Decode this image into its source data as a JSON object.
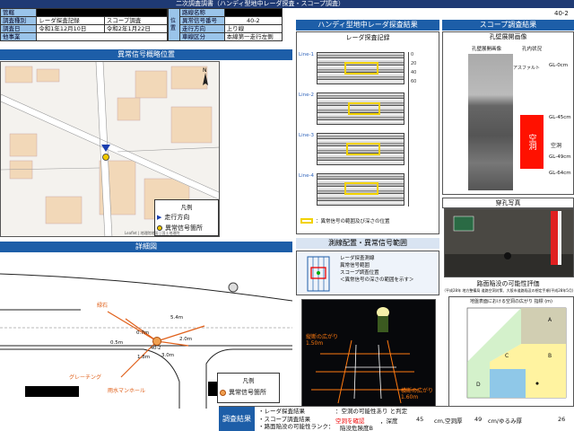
{
  "header": {
    "title": "二次調査調書（ハンディ型地中レーダ探査・スコープ調査）",
    "page_id": "40-2"
  },
  "info": {
    "l1": "管轄",
    "l2": "調査種別",
    "v2a": "レーダ探査記録",
    "v2b": "スコープ調査",
    "l3": "調査日",
    "v3a": "令和1年12月10日",
    "v3b": "令和2年1月22日",
    "l4": "他事業",
    "pos": "位置",
    "l5": "路線名称",
    "l6": "異常信号番号",
    "v6": "40-2",
    "l7": "走行方向",
    "v7": "上り線",
    "l8": "車線区分",
    "v8": "本線第一走行左側"
  },
  "map": {
    "title": "異常信号概略位置",
    "legend_title": "凡例",
    "legend_dir": "走行方向",
    "legend_sig": "異常信号箇所",
    "credit": "Leaflet | 地理院地図 | 国土地理院"
  },
  "detail": {
    "title": "詳細図",
    "legend_title": "凡例",
    "legend_sig": "異常信号箇所",
    "callouts": [
      "緑石",
      "グレーチング",
      "雨水マンホール"
    ],
    "dims": [
      "5.4m",
      "0.7m",
      "2.0m",
      "3.0m",
      "0.5m",
      "1.8m"
    ],
    "mark": "40-2"
  },
  "radar": {
    "title": "ハンディ型地中レーダ探査結果",
    "sub": "レーダ探査記録",
    "lines": [
      "Line-1",
      "Line-2",
      "Line-3",
      "Line-4"
    ],
    "depth_ticks": [
      "0",
      "20",
      "40",
      "60"
    ],
    "legend": "：異常信号の範囲及び深さの位置",
    "meas_title": "測線配置・異常信号範囲",
    "meas_legend": [
      "レーダ探査測線",
      "異常信号範囲",
      "スコープ調査位置",
      "＜異常信号の深さの範囲を示す＞"
    ],
    "photo_labels": [
      "縦断の広がり",
      "1.50m",
      "横断の広がり",
      "1.60m"
    ]
  },
  "scope": {
    "title": "スコープ調査結果",
    "sub": "孔壁展開画像",
    "cols": [
      "孔壁展開画像",
      "孔内状況"
    ],
    "asphalt": "アスファルト",
    "void": "空洞",
    "void_label": "空洞",
    "depth_labels": [
      "GL-0cm",
      "GL-45cm",
      "GL-49cm",
      "GL-64cm"
    ],
    "photo_title": "穿孔写真",
    "risk_title": "路面陥没の可能性評価",
    "risk_sub": "（平成28年 地方整備局 道路空洞対策、大阪市道路陥没の想定手順(平成28年5月)",
    "chart_title": "地盤表面における空洞の広がり 指標 (m)",
    "risk_labels": [
      "A",
      "B",
      "C",
      "D"
    ]
  },
  "summary": {
    "title": "調査結果",
    "r1": "・レーダ探査結果",
    "r2": "・スコープ調査結果",
    "r3": "・路面陥没の可能性ランク：",
    "judge": "：空洞の可能性あり",
    "judge_end": "と判定",
    "confirm": "空洞を確認",
    "depth_label": "，深度",
    "v_depth": "45",
    "unit_depth": "cm,空洞厚",
    "v_thick": "49",
    "unit_thick": "cm/ゆるみ厚",
    "v_loose": "26",
    "rank": "陥没危険度B"
  },
  "colors": {
    "accent": "#1d5ea8",
    "navy": "#1f3a74",
    "void": "#ff1100",
    "label": "#9ac4ea"
  }
}
